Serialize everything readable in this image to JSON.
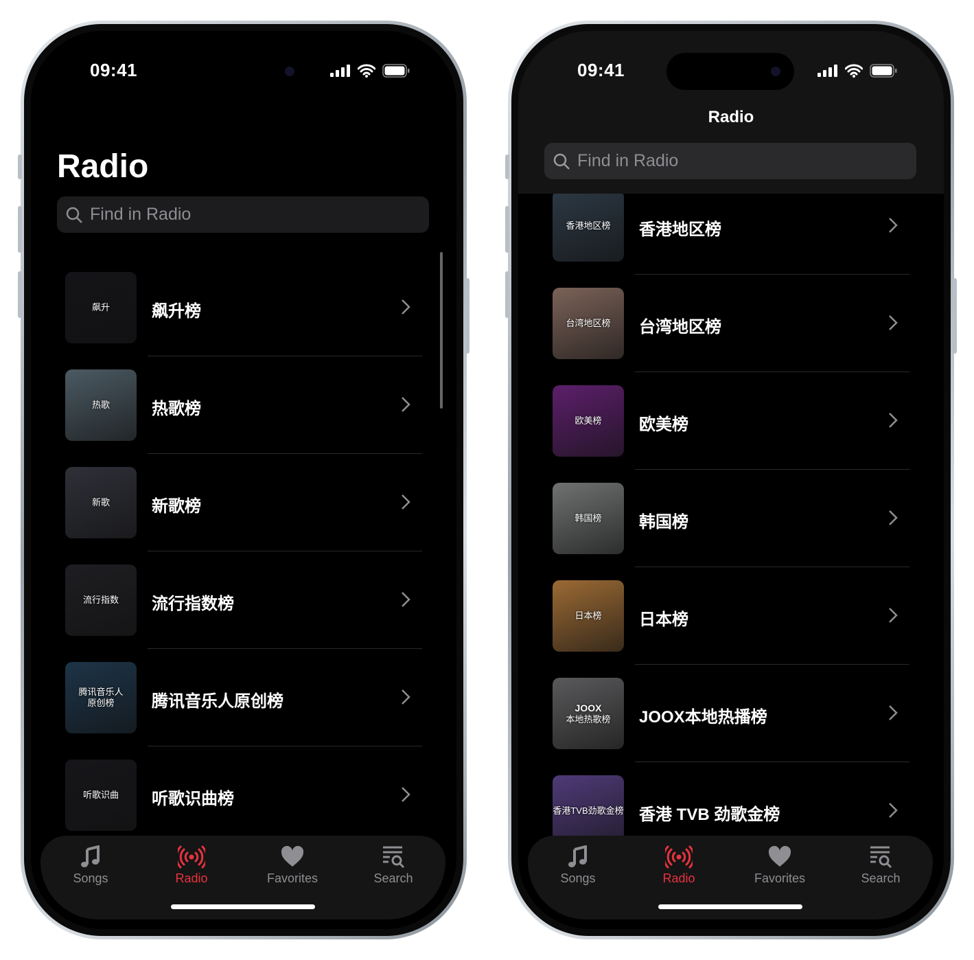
{
  "accent": "#e8333f",
  "status": {
    "time": "09:41"
  },
  "left": {
    "title": "Radio",
    "search_placeholder": "Find in Radio",
    "items": [
      {
        "label": "飙升榜",
        "thumb": [
          "飙升"
        ],
        "color": "#141418"
      },
      {
        "label": "热歌榜",
        "thumb": [
          "热歌"
        ],
        "color": "#4b5a63"
      },
      {
        "label": "新歌榜",
        "thumb": [
          "新歌"
        ],
        "color": "#2f3038"
      },
      {
        "label": "流行指数榜",
        "thumb": [
          "流行指数"
        ],
        "color": "#1e1e22"
      },
      {
        "label": "腾讯音乐人原创榜",
        "thumb": [
          "腾讯音乐人",
          "原创榜"
        ],
        "color": "#1d3448"
      },
      {
        "label": "听歌识曲榜",
        "thumb": [
          "听歌识曲"
        ],
        "color": "#16161a"
      }
    ]
  },
  "right": {
    "title": "Radio",
    "search_placeholder": "Find in Radio",
    "items": [
      {
        "label": "香港地区榜",
        "thumb": [
          "香港地区榜"
        ],
        "color": "#2c3844"
      },
      {
        "label": "台湾地区榜",
        "thumb": [
          "台湾地区榜"
        ],
        "color": "#7b6258"
      },
      {
        "label": "欧美榜",
        "thumb": [
          "欧美榜"
        ],
        "color": "#5c1f6a"
      },
      {
        "label": "韩国榜",
        "thumb": [
          "韩国榜"
        ],
        "color": "#707272"
      },
      {
        "label": "日本榜",
        "thumb": [
          "日本榜"
        ],
        "color": "#9b6a34"
      },
      {
        "label": "JOOX本地热播榜",
        "thumb": [
          "JOOX",
          "本地热歌榜"
        ],
        "color": "#5a5a5c"
      },
      {
        "label": "香港 TVB 劲歌金榜",
        "thumb": [
          "香港TVB劲歌金榜"
        ],
        "color": "#4f3a78"
      }
    ]
  },
  "tabs": [
    {
      "label": "Songs",
      "icon": "music-note-icon",
      "active": false
    },
    {
      "label": "Radio",
      "icon": "radio-broadcast-icon",
      "active": true
    },
    {
      "label": "Favorites",
      "icon": "heart-icon",
      "active": false
    },
    {
      "label": "Search",
      "icon": "search-list-icon",
      "active": false
    }
  ]
}
